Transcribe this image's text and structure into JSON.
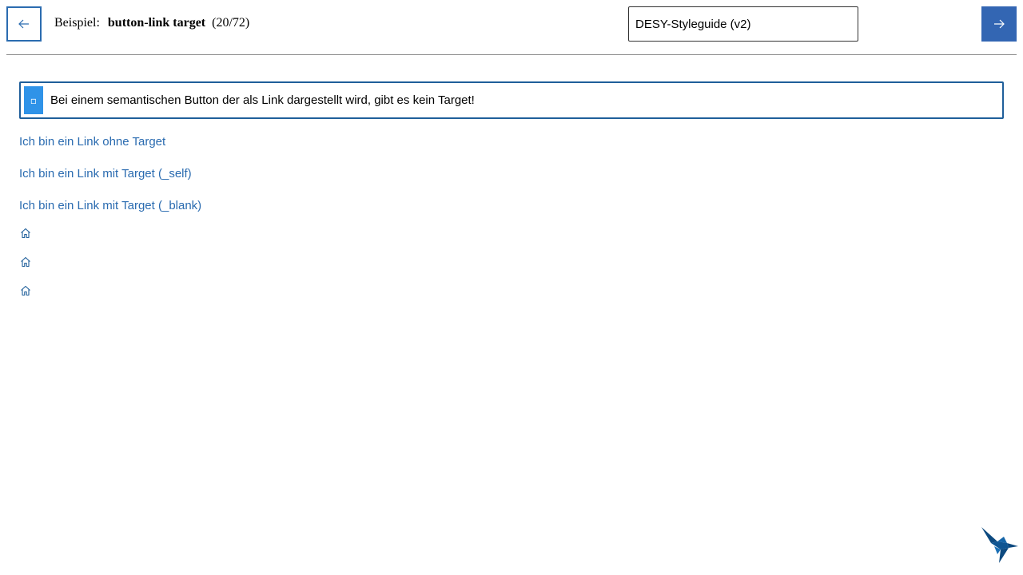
{
  "header": {
    "prev_icon": "arrow-left-icon",
    "next_icon": "arrow-right-icon",
    "title_prefix": "Beispiel:",
    "title_name": "button-link target",
    "title_counter": "(20/72)",
    "styleguide_select_value": "DESY-Styleguide (v2)"
  },
  "notice": {
    "icon": "info-icon",
    "text": "Bei einem semantischen Button der als Link dargestellt wird, gibt es kein Target!"
  },
  "links": [
    {
      "label": "Ich bin ein Link ohne Target"
    },
    {
      "label": "Ich bin ein Link mit Target (_self)"
    },
    {
      "label": "Ich bin ein Link mit Target (_blank)"
    }
  ],
  "icon_links": [
    "home-icon",
    "home-icon",
    "home-icon"
  ],
  "colors": {
    "accent": "#2a6bb0",
    "next_button_bg": "#3366b3",
    "notice_border": "#1f5f9a",
    "notice_icon_bg": "#2f93e8",
    "logo": "#0d4a80"
  },
  "logo_icon": "hummingbird-logo-icon"
}
